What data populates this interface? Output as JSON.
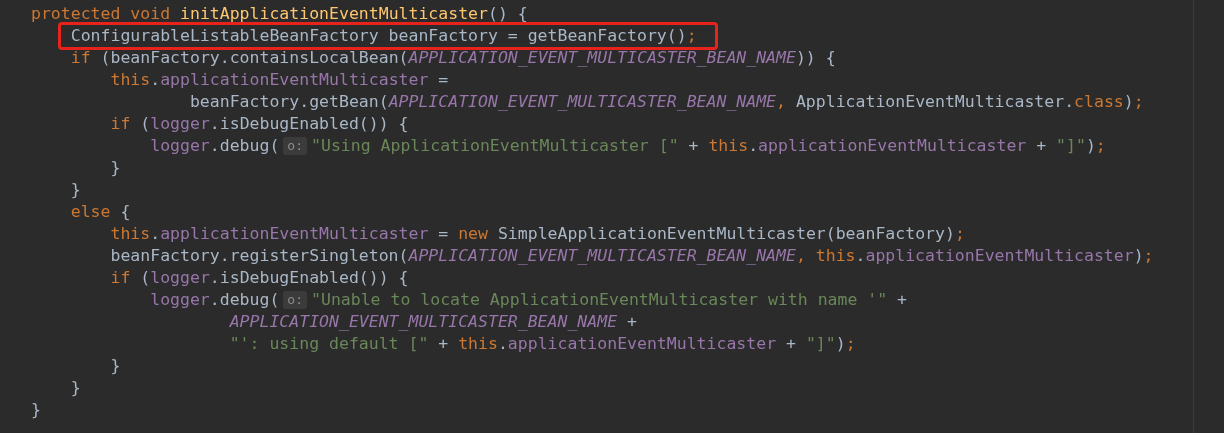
{
  "editor": {
    "lines": [
      {
        "highlighted": false,
        "segments": [
          {
            "kind": "code",
            "tokens": [
              {
                "kind": "keyword",
                "text": "protected void "
              },
              {
                "kind": "method",
                "text": "initApplicationEventMulticaster"
              },
              {
                "kind": "plain",
                "text": "() {"
              }
            ]
          }
        ]
      },
      {
        "highlighted": true,
        "segments": [
          {
            "kind": "code",
            "tokens": [
              {
                "kind": "plain",
                "text": "    ConfigurableListableBeanFactory beanFactory = getBeanFactory()"
              },
              {
                "kind": "keyword",
                "text": ";"
              }
            ]
          }
        ]
      },
      {
        "highlighted": false,
        "segments": [
          {
            "kind": "code",
            "tokens": [
              {
                "kind": "keyword",
                "text": "    if "
              },
              {
                "kind": "plain",
                "text": "(beanFactory.containsLocalBean("
              },
              {
                "kind": "constant",
                "text": "APPLICATION_EVENT_MULTICASTER_BEAN_NAME"
              },
              {
                "kind": "plain",
                "text": ")) {"
              }
            ]
          }
        ]
      },
      {
        "highlighted": false,
        "segments": [
          {
            "kind": "code",
            "tokens": [
              {
                "kind": "keyword",
                "text": "        this"
              },
              {
                "kind": "plain",
                "text": "."
              },
              {
                "kind": "field",
                "text": "applicationEventMulticaster"
              },
              {
                "kind": "plain",
                "text": " ="
              }
            ]
          }
        ]
      },
      {
        "highlighted": false,
        "segments": [
          {
            "kind": "code",
            "tokens": [
              {
                "kind": "plain",
                "text": "                beanFactory.getBean("
              },
              {
                "kind": "constant",
                "text": "APPLICATION_EVENT_MULTICASTER_BEAN_NAME"
              },
              {
                "kind": "keyword",
                "text": ", "
              },
              {
                "kind": "plain",
                "text": "ApplicationEventMulticaster."
              },
              {
                "kind": "keyword",
                "text": "class"
              },
              {
                "kind": "plain",
                "text": ")"
              },
              {
                "kind": "keyword",
                "text": ";"
              }
            ]
          }
        ]
      },
      {
        "highlighted": false,
        "segments": [
          {
            "kind": "code",
            "tokens": [
              {
                "kind": "keyword",
                "text": "        if "
              },
              {
                "kind": "plain",
                "text": "("
              },
              {
                "kind": "field",
                "text": "logger"
              },
              {
                "kind": "plain",
                "text": ".isDebugEnabled()) {"
              }
            ]
          }
        ]
      },
      {
        "highlighted": false,
        "segments": [
          {
            "kind": "code",
            "tokens": [
              {
                "kind": "field",
                "text": "            logger"
              },
              {
                "kind": "plain",
                "text": ".debug("
              }
            ]
          },
          {
            "kind": "hint",
            "text": "o:"
          },
          {
            "kind": "code",
            "tokens": [
              {
                "kind": "string",
                "text": "\"Using ApplicationEventMulticaster [\""
              },
              {
                "kind": "plain",
                "text": " + "
              },
              {
                "kind": "keyword",
                "text": "this"
              },
              {
                "kind": "plain",
                "text": "."
              },
              {
                "kind": "field",
                "text": "applicationEventMulticaster"
              },
              {
                "kind": "plain",
                "text": " + "
              },
              {
                "kind": "string",
                "text": "\"]\""
              },
              {
                "kind": "plain",
                "text": ")"
              },
              {
                "kind": "keyword",
                "text": ";"
              }
            ]
          }
        ]
      },
      {
        "highlighted": false,
        "segments": [
          {
            "kind": "code",
            "tokens": [
              {
                "kind": "plain",
                "text": "        }"
              }
            ]
          }
        ]
      },
      {
        "highlighted": false,
        "segments": [
          {
            "kind": "code",
            "tokens": [
              {
                "kind": "plain",
                "text": "    }"
              }
            ]
          }
        ]
      },
      {
        "highlighted": false,
        "segments": [
          {
            "kind": "code",
            "tokens": [
              {
                "kind": "keyword",
                "text": "    else"
              },
              {
                "kind": "plain",
                "text": " {"
              }
            ]
          }
        ]
      },
      {
        "highlighted": false,
        "segments": [
          {
            "kind": "code",
            "tokens": [
              {
                "kind": "keyword",
                "text": "        this"
              },
              {
                "kind": "plain",
                "text": "."
              },
              {
                "kind": "field",
                "text": "applicationEventMulticaster"
              },
              {
                "kind": "plain",
                "text": " = "
              },
              {
                "kind": "keyword",
                "text": "new"
              },
              {
                "kind": "plain",
                "text": " SimpleApplicationEventMulticaster(beanFactory)"
              },
              {
                "kind": "keyword",
                "text": ";"
              }
            ]
          }
        ]
      },
      {
        "highlighted": false,
        "segments": [
          {
            "kind": "code",
            "tokens": [
              {
                "kind": "plain",
                "text": "        beanFactory.registerSingleton("
              },
              {
                "kind": "constant",
                "text": "APPLICATION_EVENT_MULTICASTER_BEAN_NAME"
              },
              {
                "kind": "keyword",
                "text": ", this"
              },
              {
                "kind": "plain",
                "text": "."
              },
              {
                "kind": "field",
                "text": "applicationEventMulticaster"
              },
              {
                "kind": "plain",
                "text": ")"
              },
              {
                "kind": "keyword",
                "text": ";"
              }
            ]
          }
        ]
      },
      {
        "highlighted": false,
        "segments": [
          {
            "kind": "code",
            "tokens": [
              {
                "kind": "keyword",
                "text": "        if "
              },
              {
                "kind": "plain",
                "text": "("
              },
              {
                "kind": "field",
                "text": "logger"
              },
              {
                "kind": "plain",
                "text": ".isDebugEnabled()) {"
              }
            ]
          }
        ]
      },
      {
        "highlighted": false,
        "segments": [
          {
            "kind": "code",
            "tokens": [
              {
                "kind": "field",
                "text": "            logger"
              },
              {
                "kind": "plain",
                "text": ".debug("
              }
            ]
          },
          {
            "kind": "hint",
            "text": "o:"
          },
          {
            "kind": "code",
            "tokens": [
              {
                "kind": "string",
                "text": "\"Unable to locate ApplicationEventMulticaster with name '\""
              },
              {
                "kind": "plain",
                "text": " +"
              }
            ]
          }
        ]
      },
      {
        "highlighted": false,
        "segments": [
          {
            "kind": "code",
            "tokens": [
              {
                "kind": "constant",
                "text": "                    APPLICATION_EVENT_MULTICASTER_BEAN_NAME"
              },
              {
                "kind": "plain",
                "text": " +"
              }
            ]
          }
        ]
      },
      {
        "highlighted": false,
        "segments": [
          {
            "kind": "code",
            "tokens": [
              {
                "kind": "string",
                "text": "                    \"': using default [\""
              },
              {
                "kind": "plain",
                "text": " + "
              },
              {
                "kind": "keyword",
                "text": "this"
              },
              {
                "kind": "plain",
                "text": "."
              },
              {
                "kind": "field",
                "text": "applicationEventMulticaster"
              },
              {
                "kind": "plain",
                "text": " + "
              },
              {
                "kind": "string",
                "text": "\"]\""
              },
              {
                "kind": "plain",
                "text": ")"
              },
              {
                "kind": "keyword",
                "text": ";"
              }
            ]
          }
        ]
      },
      {
        "highlighted": false,
        "segments": [
          {
            "kind": "code",
            "tokens": [
              {
                "kind": "plain",
                "text": "        }"
              }
            ]
          }
        ]
      },
      {
        "highlighted": false,
        "segments": [
          {
            "kind": "code",
            "tokens": [
              {
                "kind": "plain",
                "text": "    }"
              }
            ]
          }
        ]
      },
      {
        "highlighted": false,
        "segments": [
          {
            "kind": "code",
            "tokens": [
              {
                "kind": "plain",
                "text": "}"
              }
            ]
          }
        ]
      }
    ]
  }
}
